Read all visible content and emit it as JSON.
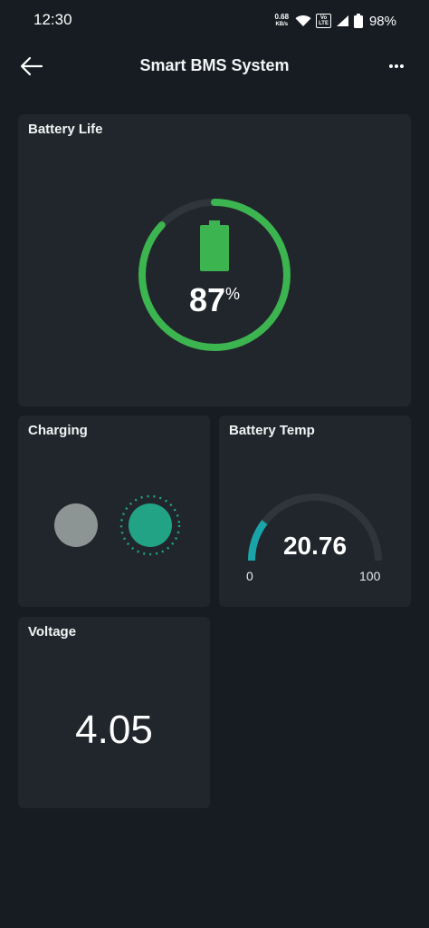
{
  "status_bar": {
    "time": "12:30",
    "net_speed_value": "0.68",
    "net_speed_unit": "KB/s",
    "volte_top": "Vo",
    "volte_bottom": "LTE",
    "battery_percent": "98%"
  },
  "app_bar": {
    "title": "Smart BMS System",
    "back_icon": "arrow-left-icon",
    "more_icon": "more-horizontal-icon"
  },
  "widgets": {
    "battery_life": {
      "title": "Battery Life",
      "value": "87",
      "unit": "%",
      "level": 0.87,
      "color": "#3cb44f",
      "track_color": "#2e353b"
    },
    "charging": {
      "title": "Charging",
      "led_off_color": "#8c9494",
      "led_on_color": "#22a386"
    },
    "battery_temp": {
      "title": "Battery Temp",
      "value": "20.76",
      "min": "0",
      "max": "100",
      "level": 0.2076,
      "color": "#1aa3a8",
      "track_color": "#2e353b"
    },
    "voltage": {
      "title": "Voltage",
      "value": "4.05"
    }
  }
}
